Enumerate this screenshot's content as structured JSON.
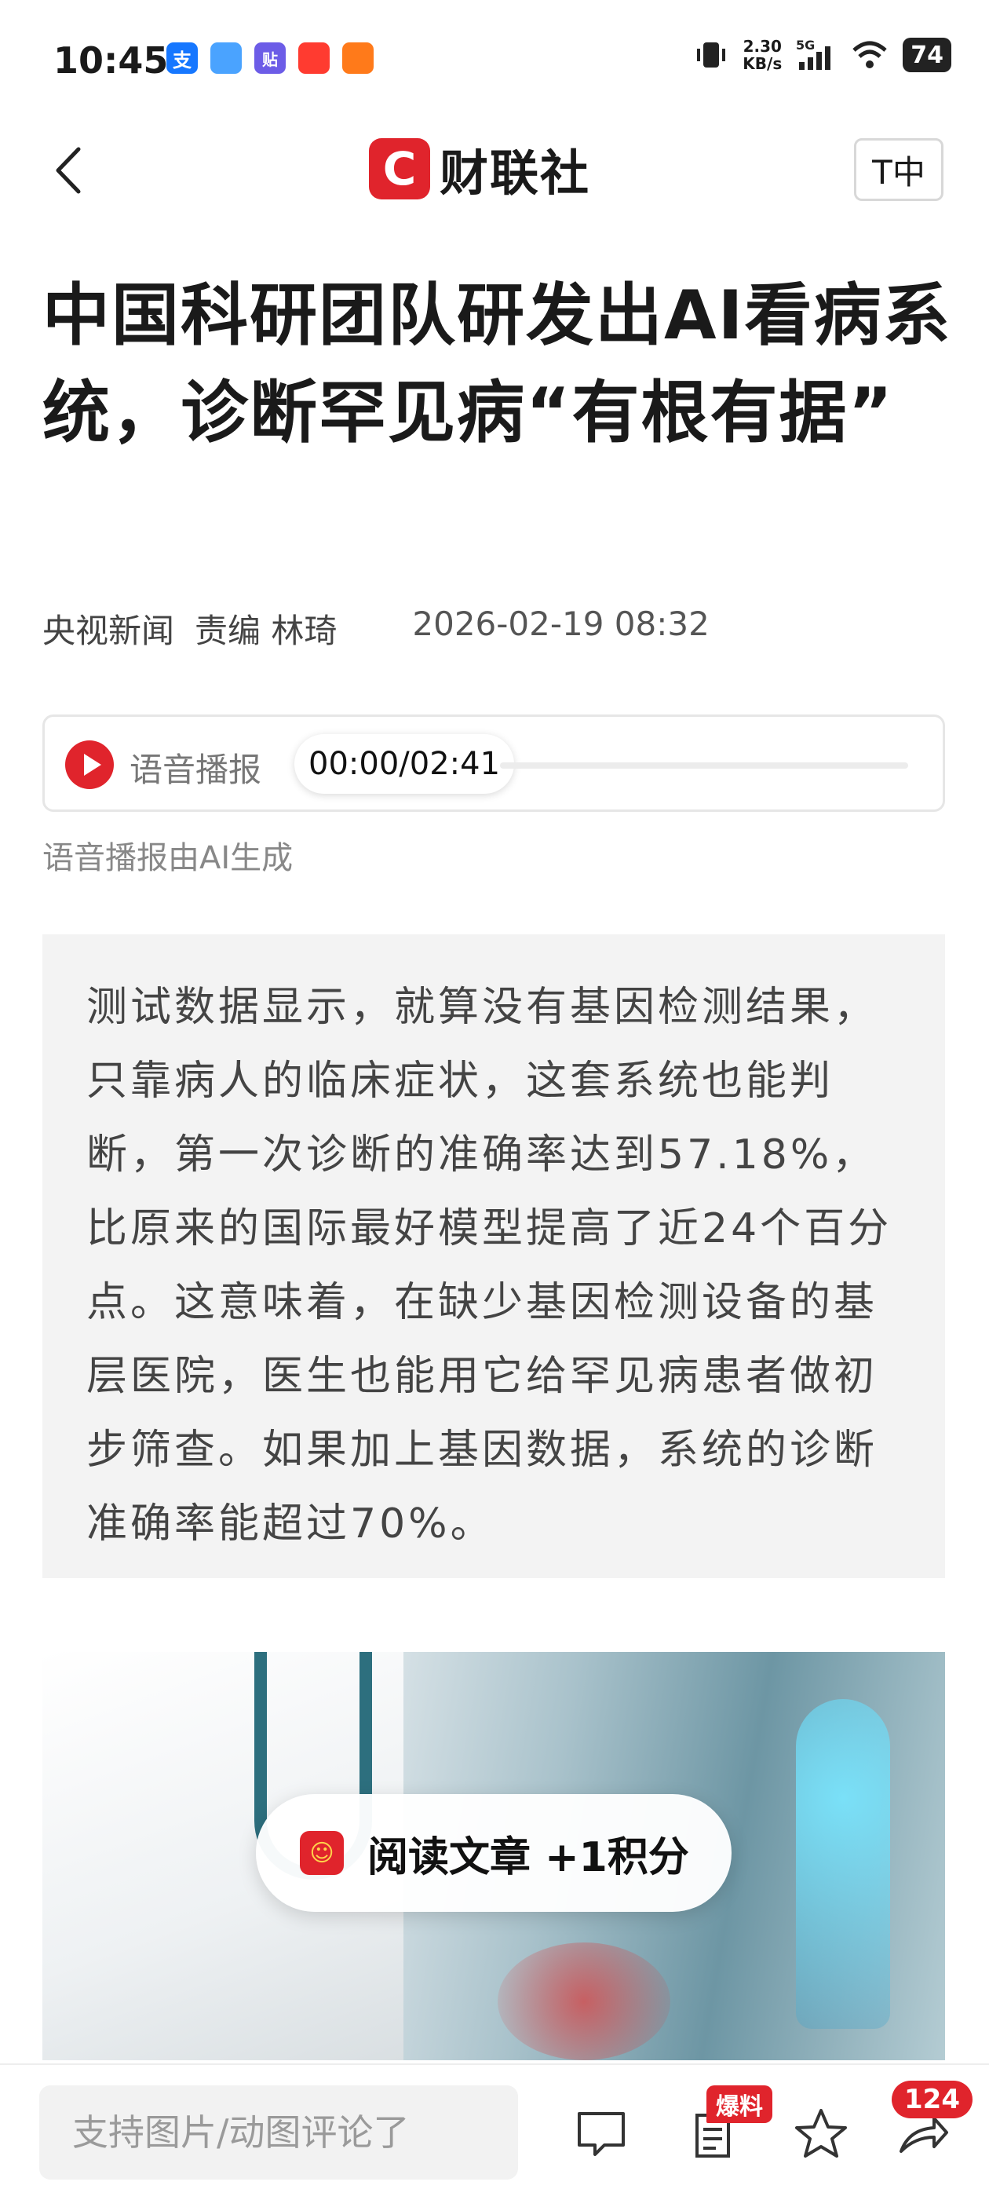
{
  "status_bar": {
    "time": "10:45",
    "apps": [
      {
        "icon": "alipay-icon",
        "glyph": "支",
        "color": "#1677ff"
      },
      {
        "icon": "cloud-icon",
        "glyph": "",
        "color": "#4aa3ff"
      },
      {
        "icon": "tieba-icon",
        "glyph": "贴",
        "color": "#6c5ce7"
      },
      {
        "icon": "weibo-icon",
        "glyph": "",
        "color": "#ff3b30"
      },
      {
        "icon": "taobao-icon",
        "glyph": "",
        "color": "#ff7a1a"
      }
    ],
    "net_speed": "2.30",
    "net_unit": "KB/s",
    "network": "5G",
    "battery": "74"
  },
  "header": {
    "logo_mark": "C",
    "logo_text": "财联社",
    "font_button": "T中"
  },
  "article": {
    "title": "中国科研团队研发出AI看病系统，诊断罕见病“有根有据”",
    "source": "央视新闻",
    "editor": "责编 林琦",
    "date": "2026-02-19 08:32",
    "audio": {
      "label": "语音播报",
      "time": "00:00/02:41",
      "progress": 0,
      "note": "语音播报由AI生成"
    },
    "summary": "测试数据显示，就算没有基因检测结果，只靠病人的临床症状，这套系统也能判断，第一次诊断的准确率达到57.18%，比原来的国际最好模型提高了近24个百分点。这意味着，在缺少基因检测设备的基层医院，医生也能用它给罕见病患者做初步筛查。如果加上基因数据，系统的诊断准确率能超过70%。"
  },
  "toast": {
    "text": "阅读文章 +1积分"
  },
  "bottom_bar": {
    "comment_placeholder": "支持图片/动图评论了",
    "baoliao_badge": "爆料",
    "comment_count": "124"
  },
  "colors": {
    "brand_red": "#e0242c",
    "summary_bg": "#f3f3f3"
  }
}
